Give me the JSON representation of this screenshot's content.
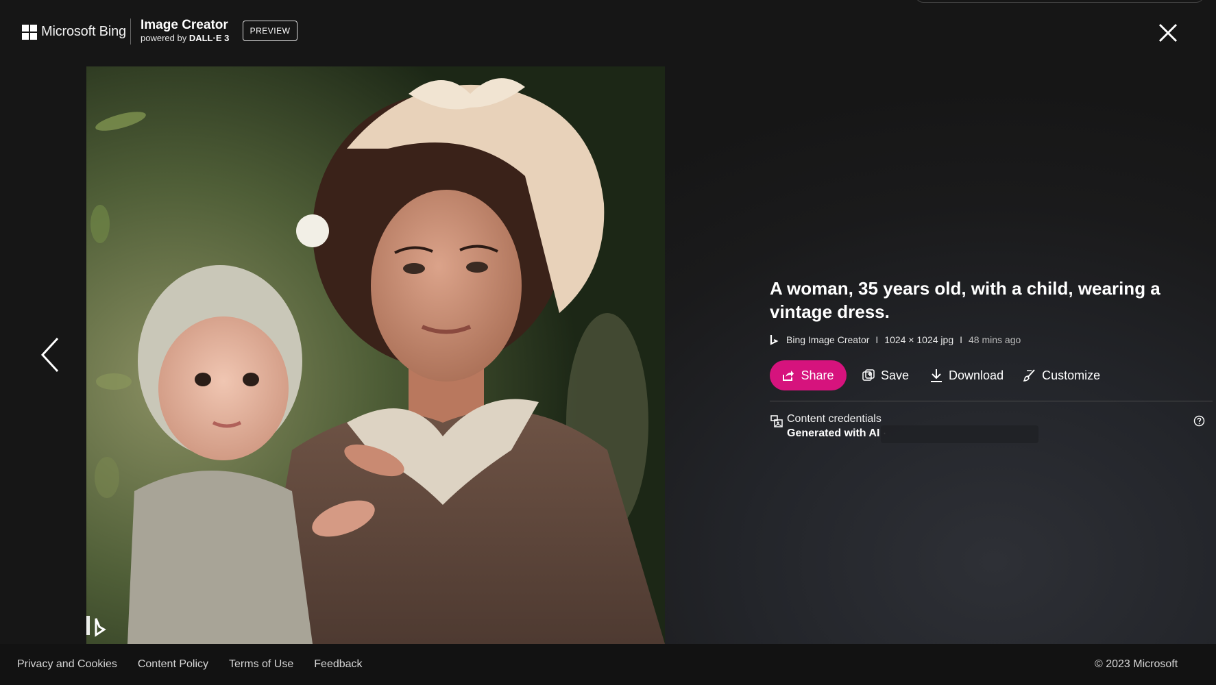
{
  "header": {
    "brand": "Microsoft Bing",
    "product_title": "Image Creator",
    "powered_by_prefix": "powered by",
    "powered_by_model": "DALL·E 3",
    "badge": "PREVIEW",
    "close_icon": "close-icon"
  },
  "navigation": {
    "prev_icon": "chevron-left-icon"
  },
  "image": {
    "watermark_icon": "bing-logo-icon"
  },
  "details": {
    "title": "A woman, 35 years old, with a child, wearing a vintage dress.",
    "source": "Bing Image Creator",
    "separator": "I",
    "dimensions": "1024 × 1024 jpg",
    "time_ago": "48 mins ago",
    "actions": {
      "share": "Share",
      "save": "Save",
      "download": "Download",
      "customize": "Customize"
    },
    "accent_color": "#d6137d",
    "credentials": {
      "label": "Content credentials",
      "value": "Generated with AI",
      "value_suffix": "·"
    }
  },
  "footer": {
    "links": [
      "Privacy and Cookies",
      "Content Policy",
      "Terms of Use",
      "Feedback"
    ],
    "copyright": "© 2023 Microsoft"
  }
}
